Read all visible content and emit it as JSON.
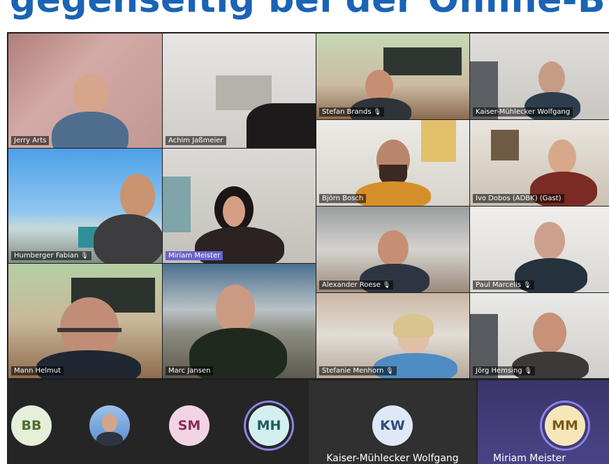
{
  "headline": "gegenseitig bei der Online-B",
  "participants": [
    {
      "name": "Jerry Arts"
    },
    {
      "name": "Achim Jaßmeier"
    },
    {
      "name": "Stefan Brands"
    },
    {
      "name": "Kaiser-Mühlecker Wolfgang"
    },
    {
      "name": "Björn Bosch"
    },
    {
      "name": "Ivo Dobos (ADBK) (Gast)"
    },
    {
      "name": "Humberger Fabian"
    },
    {
      "name": "Miriam Meister"
    },
    {
      "name": "Alexander Roese"
    },
    {
      "name": "Paul Marcelis"
    },
    {
      "name": "Mann Helmut"
    },
    {
      "name": "Marc Jansen"
    },
    {
      "name": "Stefanie Menhorn"
    },
    {
      "name": "Jörg Hemsing"
    }
  ],
  "strip": {
    "avatars": [
      {
        "initials": "BB",
        "bg": "#e6efd9",
        "fg": "#4e6f2c"
      },
      {
        "initials": "",
        "bg": "#5b8bd0"
      },
      {
        "initials": "SM",
        "bg": "#f2d4e4",
        "fg": "#8b2c5c"
      },
      {
        "initials": "MH",
        "bg": "#d3efef",
        "fg": "#1e5c5c"
      }
    ],
    "large": [
      {
        "initials": "KW",
        "name": "Kaiser-Mühlecker Wolfgang",
        "bg": "#dfe8f6",
        "fg": "#2d4d7e"
      },
      {
        "initials": "MM",
        "name": "Miriam Meister",
        "bg": "#f5e7b9",
        "fg": "#7a5a12"
      }
    ]
  },
  "colors": {
    "headline": "#1a63b5",
    "active_speaker": "#6b62c9",
    "ring": "#8b84e6"
  }
}
